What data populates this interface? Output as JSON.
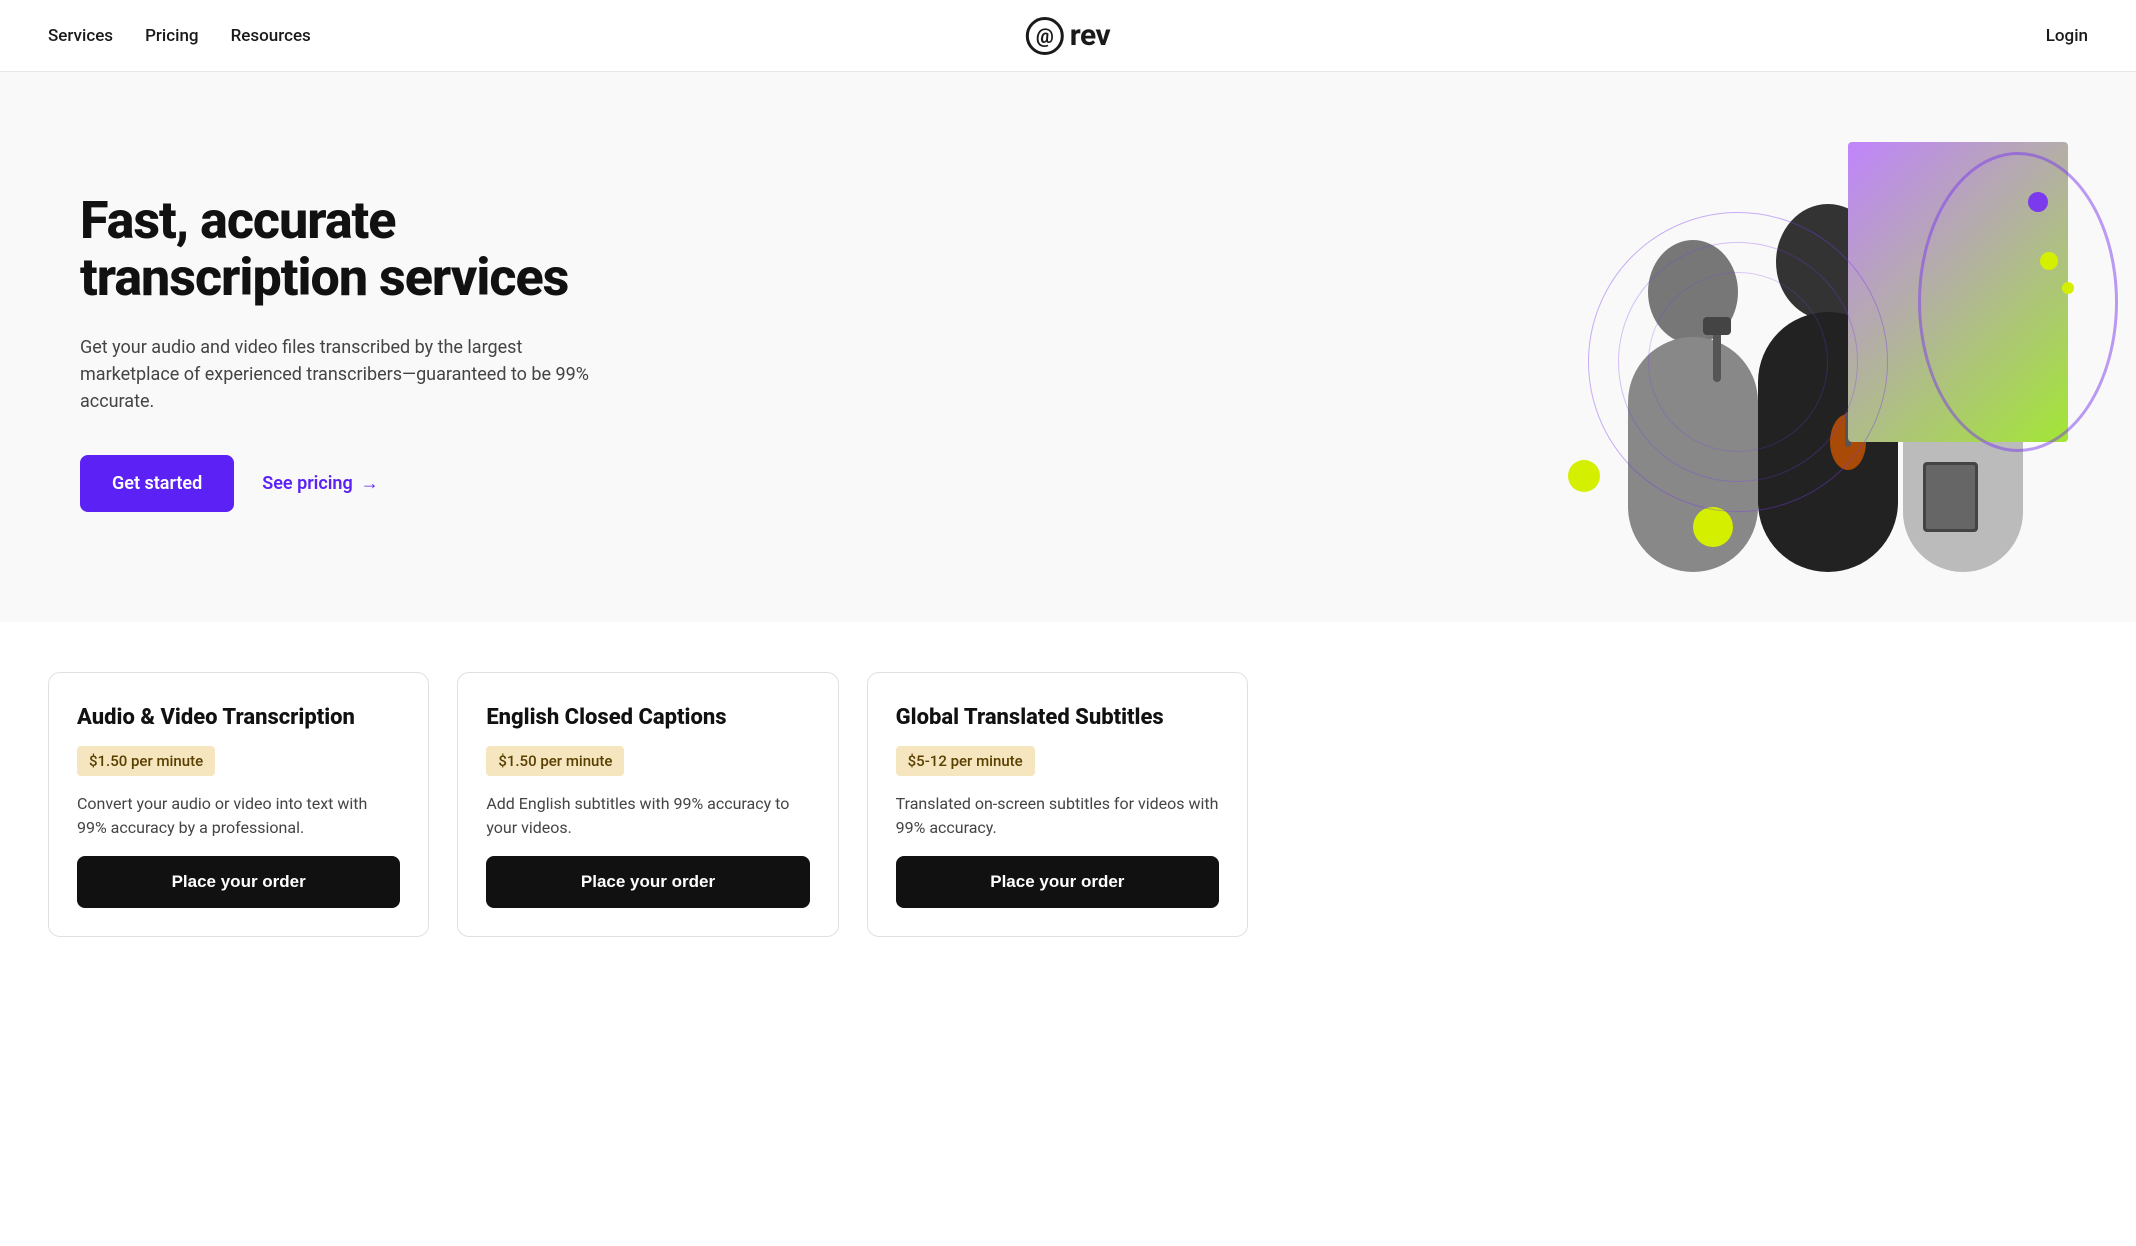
{
  "header": {
    "nav_left": [
      {
        "label": "Services",
        "id": "services"
      },
      {
        "label": "Pricing",
        "id": "pricing"
      },
      {
        "label": "Resources",
        "id": "resources"
      }
    ],
    "logo": {
      "at_symbol": "@",
      "brand": "rev"
    },
    "nav_right": {
      "login_label": "Login"
    }
  },
  "hero": {
    "title": "Fast, accurate transcription services",
    "subtitle": "Get your audio and video files transcribed by the largest marketplace of experienced transcribers—guaranteed to be 99% accurate.",
    "cta_primary": "Get started",
    "cta_secondary": "See pricing",
    "cta_arrow": "→"
  },
  "services": {
    "cards": [
      {
        "title": "Audio & Video Transcription",
        "price": "$1.50 per minute",
        "description": "Convert your audio or video into text with 99% accuracy by a professional.",
        "cta": "Place your order"
      },
      {
        "title": "English Closed Captions",
        "price": "$1.50 per minute",
        "description": "Add English subtitles with 99% accuracy to your videos.",
        "cta": "Place your order"
      },
      {
        "title": "Global Translated Subtitles",
        "price": "$5-12 per minute",
        "description": "Translated on-screen subtitles for videos with 99% accuracy.",
        "cta": "Place your order"
      }
    ]
  },
  "colors": {
    "primary_purple": "#5b21f5",
    "accent_yellow": "#d4f000",
    "badge_bg": "#f5e6c0",
    "hero_gradient_start": "#c084fc",
    "hero_gradient_end": "#a3e635"
  }
}
